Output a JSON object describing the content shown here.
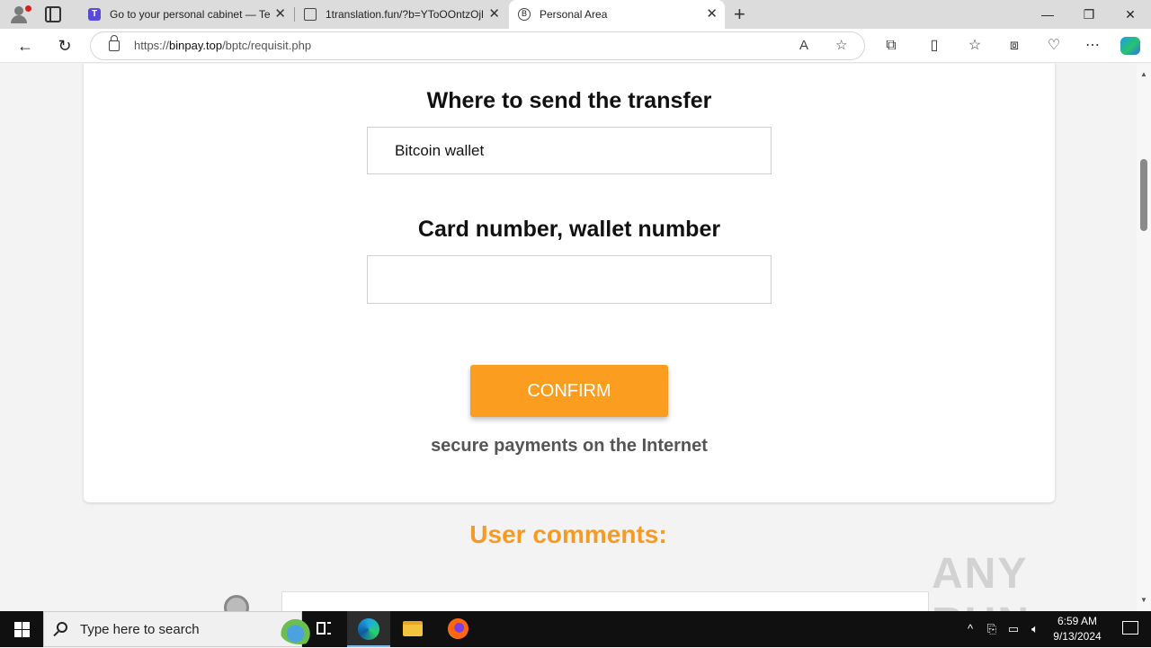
{
  "browser": {
    "tabs": [
      {
        "title": "Go to your personal cabinet — Te",
        "favicon": "telegram-t-icon"
      },
      {
        "title": "1translation.fun/?b=YToOOntzOjl",
        "favicon": "document-icon"
      },
      {
        "title": "Personal Area",
        "favicon": "b-circle-icon"
      }
    ],
    "url_prefix": "https://",
    "url_host": "binpay.top",
    "url_path": "/bptc/requisit.php"
  },
  "page": {
    "send_heading": "Where to send the transfer",
    "destination_selected": "Bitcoin wallet",
    "number_heading": "Card number, wallet number",
    "number_value": "",
    "confirm_label": "CONFIRM",
    "secure_text": "secure payments on the Internet",
    "comments_heading": "User comments:",
    "watermark": "ANY RUN"
  },
  "taskbar": {
    "search_placeholder": "Type here to search",
    "time": "6:59 AM",
    "date": "9/13/2024"
  },
  "colors": {
    "confirm_bg": "#fb9d1f",
    "comments_heading": "#f59a23"
  }
}
